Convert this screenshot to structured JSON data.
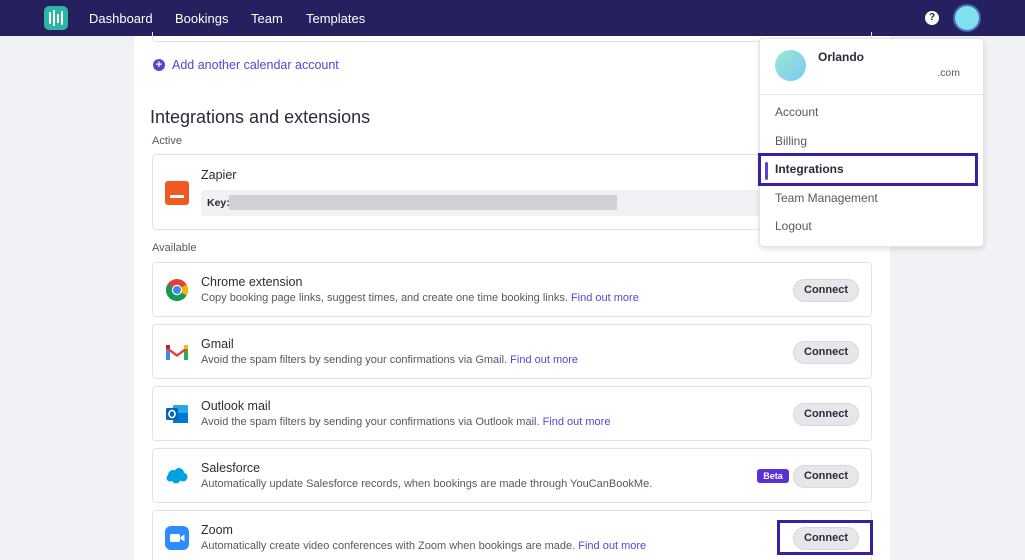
{
  "nav": {
    "items": [
      "Dashboard",
      "Bookings",
      "Team",
      "Templates"
    ],
    "help_icon": "question-circle-icon"
  },
  "calendar": {
    "add_account_label": "Add another calendar account"
  },
  "integrations": {
    "title": "Integrations and extensions",
    "active_label": "Active",
    "available_label": "Available",
    "active": [
      {
        "name": "Zapier",
        "key_label": "Key:",
        "icon": "zapier-icon",
        "color": "#f05a22"
      }
    ],
    "available": [
      {
        "name": "Chrome extension",
        "description": "Copy booking page links, suggest times, and create one time booking links.",
        "link": "Find out more",
        "button": "Connect",
        "icon": "chrome-icon"
      },
      {
        "name": "Gmail",
        "description": "Avoid the spam filters by sending your confirmations via Gmail.",
        "link": "Find out more",
        "button": "Connect",
        "icon": "gmail-icon"
      },
      {
        "name": "Outlook mail",
        "description": "Avoid the spam filters by sending your confirmations via Outlook mail.",
        "link": "Find out more",
        "button": "Connect",
        "icon": "outlook-icon"
      },
      {
        "name": "Salesforce",
        "description": "Automatically update Salesforce records, when bookings are made through YouCanBookMe.",
        "badge": "Beta",
        "button": "Connect",
        "icon": "salesforce-icon"
      },
      {
        "name": "Zoom",
        "description": "Automatically create video conferences with Zoom when bookings are made.",
        "link": "Find out more",
        "button": "Connect",
        "icon": "zoom-icon"
      }
    ]
  },
  "user_menu": {
    "name": "Orlando",
    "email": ".com",
    "items": [
      "Account",
      "Billing",
      "Integrations",
      "Team Management",
      "Logout"
    ],
    "active_item": "Integrations"
  },
  "colors": {
    "nav_bg": "#24215e",
    "accent": "#5346d6",
    "highlight": "#3a1fa6",
    "beta": "#5a2fd6"
  }
}
